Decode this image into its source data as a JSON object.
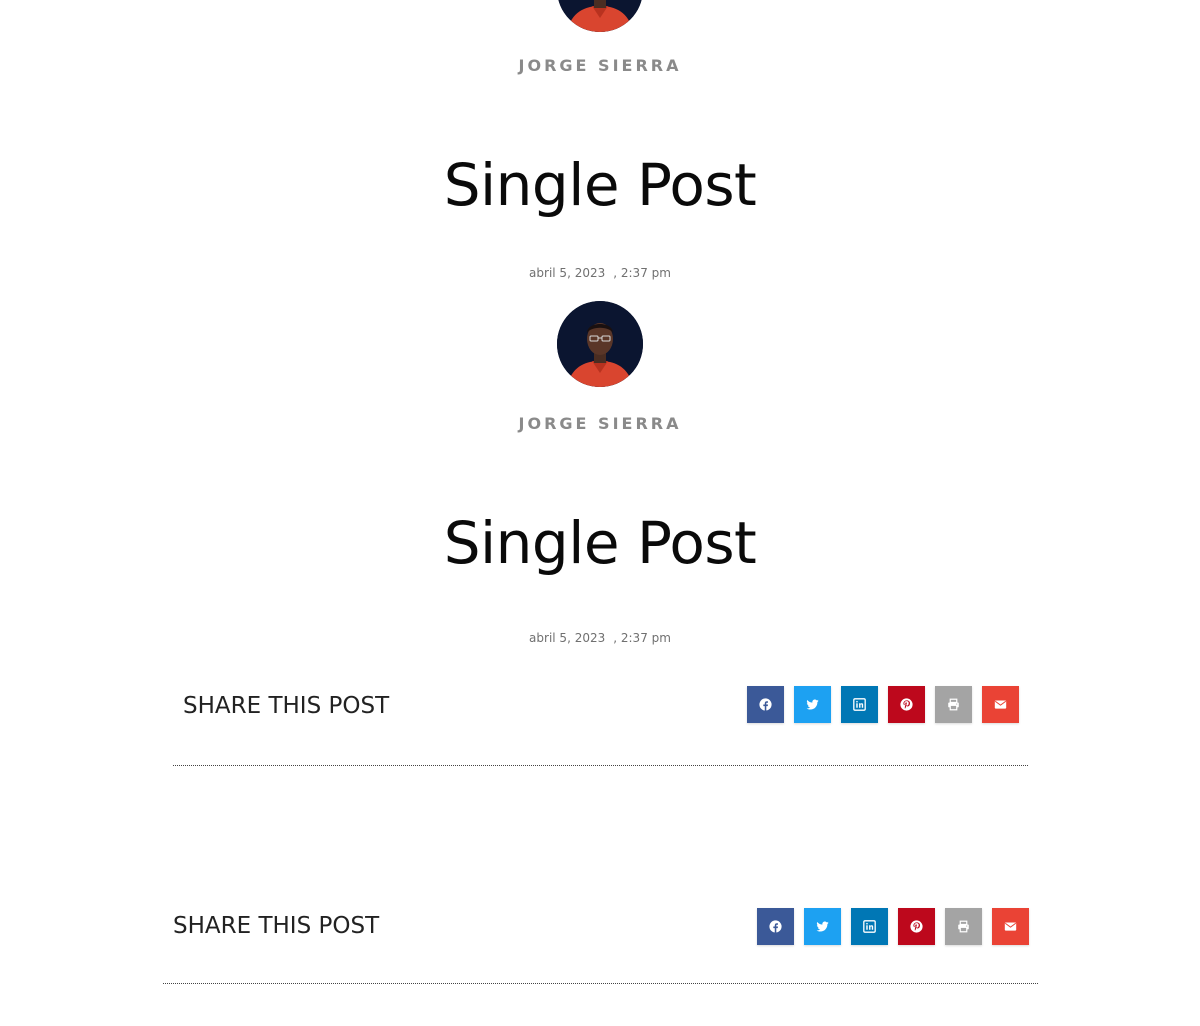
{
  "posts": [
    {
      "author": "JORGE SIERRA",
      "title": "Single Post",
      "date": "abril 5, 2023",
      "time": ", 2:37 pm"
    },
    {
      "author": "JORGE SIERRA",
      "title": "Single Post",
      "date": "abril 5, 2023",
      "time": ", 2:37 pm"
    }
  ],
  "share_sections": [
    {
      "heading": "SHARE THIS POST",
      "buttons": [
        {
          "name": "facebook",
          "icon": "facebook-icon",
          "color": "#3b5998"
        },
        {
          "name": "twitter",
          "icon": "twitter-icon",
          "color": "#1da1f2"
        },
        {
          "name": "linkedin",
          "icon": "linkedin-icon",
          "color": "#0077b5"
        },
        {
          "name": "pinterest",
          "icon": "pinterest-icon",
          "color": "#bd081c"
        },
        {
          "name": "print",
          "icon": "print-icon",
          "color": "#a4a4a4"
        },
        {
          "name": "email",
          "icon": "email-icon",
          "color": "#ea4335"
        }
      ]
    },
    {
      "heading": "SHARE THIS POST",
      "buttons": [
        {
          "name": "facebook",
          "icon": "facebook-icon",
          "color": "#3b5998"
        },
        {
          "name": "twitter",
          "icon": "twitter-icon",
          "color": "#1da1f2"
        },
        {
          "name": "linkedin",
          "icon": "linkedin-icon",
          "color": "#0077b5"
        },
        {
          "name": "pinterest",
          "icon": "pinterest-icon",
          "color": "#bd081c"
        },
        {
          "name": "print",
          "icon": "print-icon",
          "color": "#a4a4a4"
        },
        {
          "name": "email",
          "icon": "email-icon",
          "color": "#ea4335"
        }
      ]
    }
  ]
}
